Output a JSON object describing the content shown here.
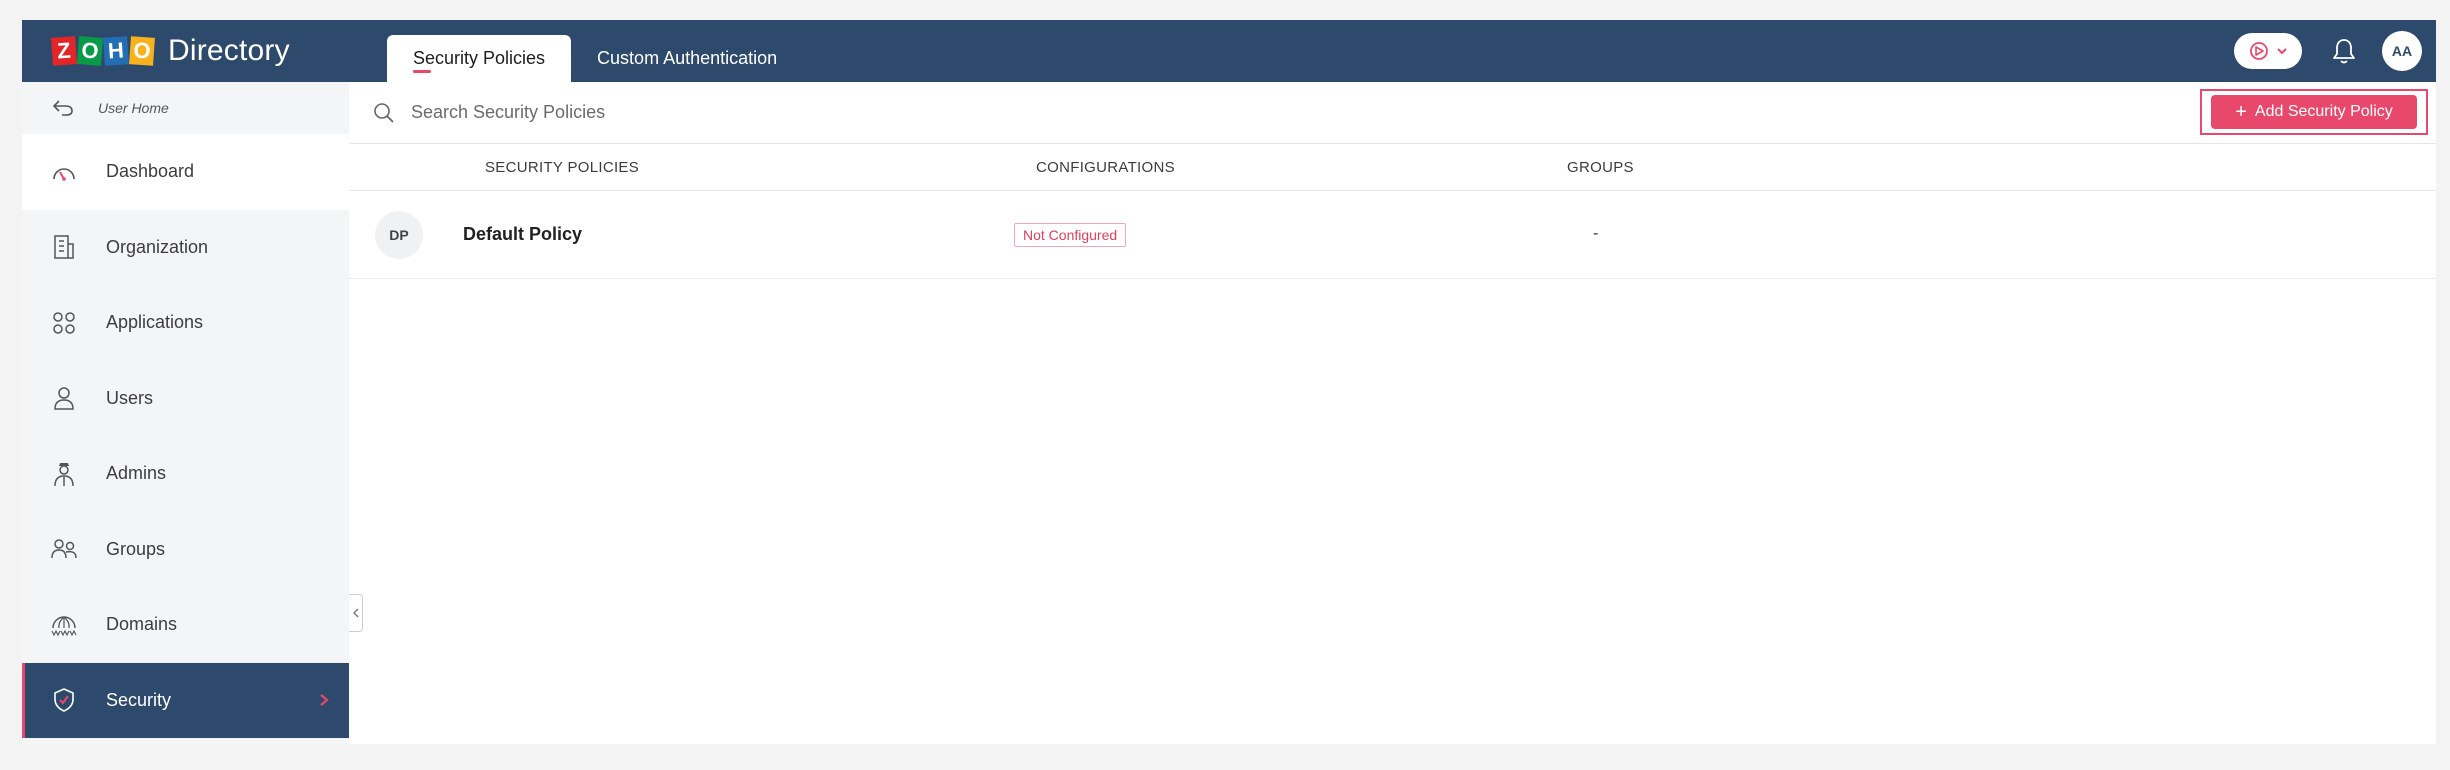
{
  "brand": {
    "logo_letters": [
      "Z",
      "O",
      "H",
      "O"
    ],
    "product": "Directory"
  },
  "tabs": [
    {
      "label": "Security Policies",
      "active": true
    },
    {
      "label": "Custom Authentication",
      "active": false
    }
  ],
  "topbar": {
    "avatar_initials": "AA"
  },
  "sidebar": {
    "back_label": "User Home",
    "items": [
      {
        "label": "Dashboard",
        "icon": "gauge-icon"
      },
      {
        "label": "Organization",
        "icon": "building-icon"
      },
      {
        "label": "Applications",
        "icon": "grid-icon"
      },
      {
        "label": "Users",
        "icon": "user-icon"
      },
      {
        "label": "Admins",
        "icon": "admin-icon"
      },
      {
        "label": "Groups",
        "icon": "group-icon"
      },
      {
        "label": "Domains",
        "icon": "globe-icon"
      },
      {
        "label": "Security",
        "icon": "shield-icon",
        "active": true
      }
    ]
  },
  "main": {
    "search_placeholder": "Search Security Policies",
    "add_button_label": "Add Security Policy",
    "columns": [
      "SECURITY POLICIES",
      "CONFIGURATIONS",
      "GROUPS"
    ],
    "rows": [
      {
        "initials": "DP",
        "name": "Default Policy",
        "configuration": "Not Configured",
        "groups": "-"
      }
    ]
  },
  "colors": {
    "header_bg": "#2d4a6d",
    "accent": "#e8486b",
    "sidebar_bg": "#f4f5f7"
  }
}
